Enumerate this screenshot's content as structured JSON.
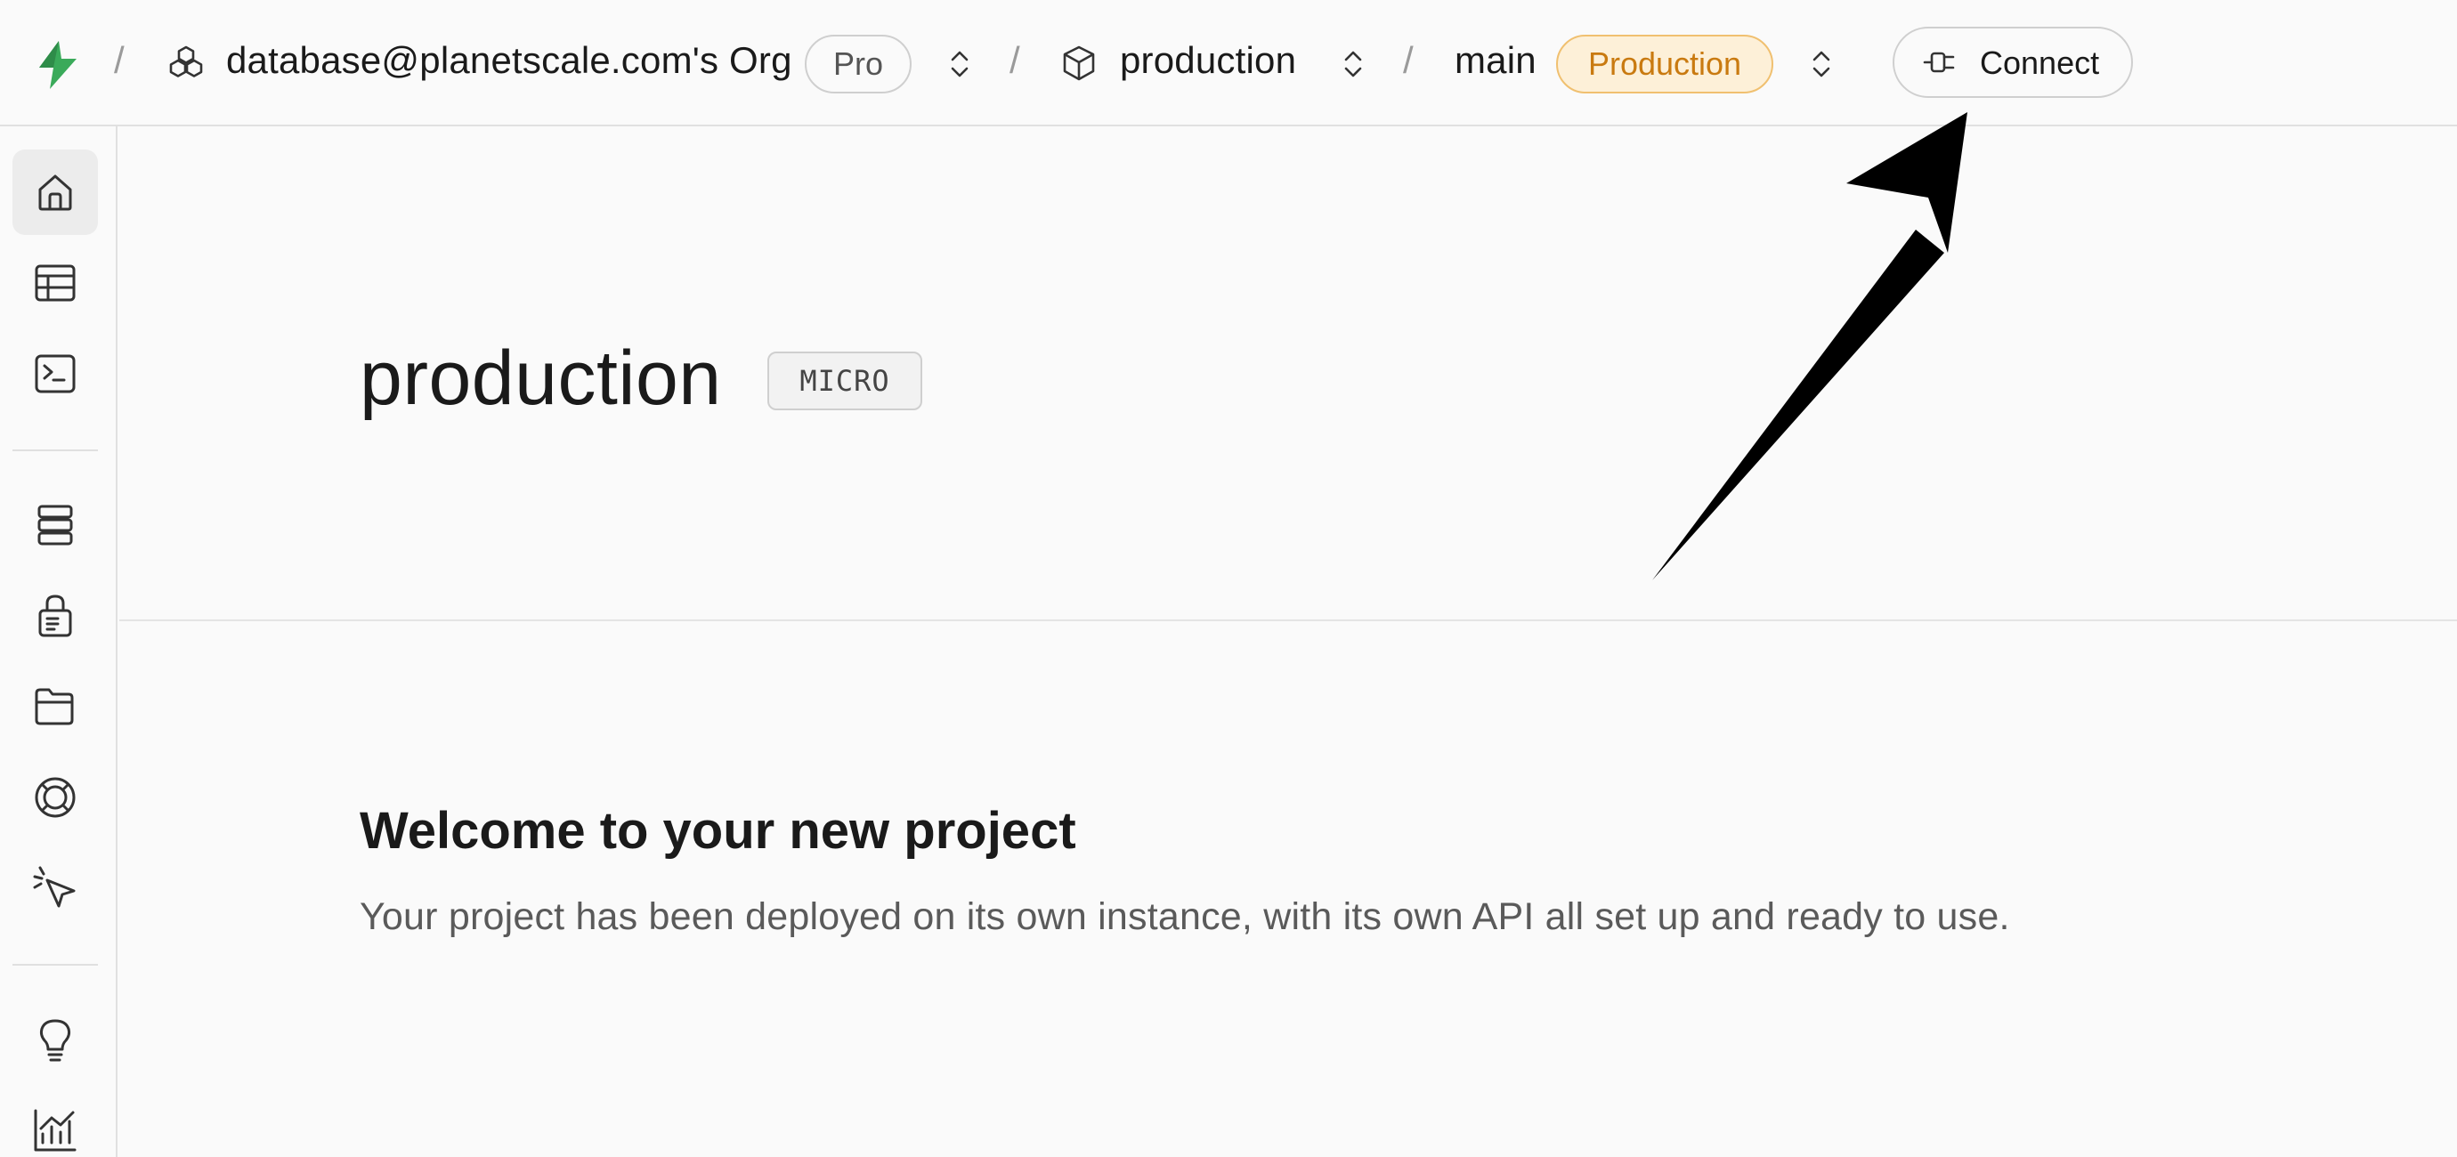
{
  "header": {
    "org_name": "database@planetscale.com's Org",
    "plan_badge": "Pro",
    "database_name": "production",
    "branch_name": "main",
    "branch_badge": "Production",
    "connect_label": "Connect",
    "separator": "/"
  },
  "colors": {
    "brand": "#3aaa5a",
    "production_badge_text": "#c97a10",
    "production_badge_bg": "#fdf0d8",
    "production_badge_border": "#f0c070"
  },
  "sidebar": {
    "items": [
      {
        "icon": "home-icon",
        "active": true
      },
      {
        "icon": "table-icon",
        "active": false
      },
      {
        "icon": "terminal-icon",
        "active": false
      },
      {
        "icon": "branches-icon",
        "active": false
      },
      {
        "icon": "lock-icon",
        "active": false
      },
      {
        "icon": "folder-icon",
        "active": false
      },
      {
        "icon": "lifebuoy-icon",
        "active": false
      },
      {
        "icon": "cursor-click-icon",
        "active": false
      },
      {
        "icon": "lightbulb-icon",
        "active": false
      },
      {
        "icon": "chart-icon",
        "active": false
      }
    ]
  },
  "main": {
    "title": "production",
    "tier": "MICRO",
    "welcome_heading": "Welcome to your new project",
    "welcome_text": "Your project has been deployed on its own instance, with its own API all set up and ready to use."
  }
}
